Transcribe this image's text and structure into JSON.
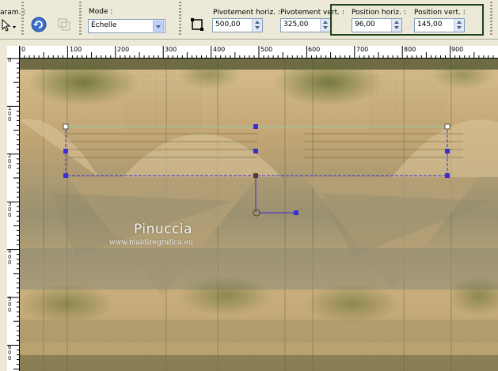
{
  "toolbar": {
    "params_label": "aram. :",
    "mode_label": "Mode :",
    "mode_value": "Échelle",
    "pivot_h_label": "Pivotement horiz. :",
    "pivot_h_value": "500,00",
    "pivot_v_label": "Pivotement vert. :",
    "pivot_v_value": "325,00",
    "pos_h_label": "Position horiz. :",
    "pos_h_value": "96,00",
    "pos_v_label": "Position vert. :",
    "pos_v_value": "145,00"
  },
  "ruler_top": {
    "labels": [
      "0",
      "100",
      "200",
      "300",
      "400",
      "500",
      "600",
      "700",
      "800",
      "900"
    ]
  },
  "ruler_left": {
    "labels": [
      "0",
      "1 0 0",
      "2 0 0",
      "3 0 0",
      "4 0 0",
      "5 0 0",
      "6 0 0"
    ]
  },
  "watermark": {
    "title": "Pinuccia",
    "subtitle": "www.maidiregrafica.eu"
  },
  "icons": {
    "select_tool": "arrow-pointer-icon",
    "reset": "undo-circle-icon",
    "disabled_tool": "ghost-tool-icon",
    "pick_pivot": "crop-frame-icon"
  }
}
